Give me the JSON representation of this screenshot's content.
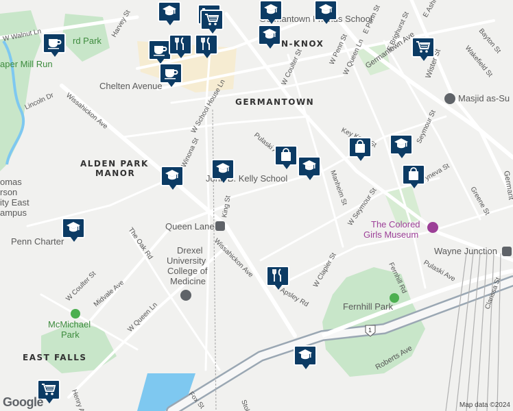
{
  "neighborhoods": [
    {
      "id": "germantown",
      "text": "GERMANTOWN"
    },
    {
      "id": "alden1",
      "text": "ALDEN PARK"
    },
    {
      "id": "alden2",
      "text": "MANOR"
    },
    {
      "id": "eastfalls",
      "text": "EAST FALLS"
    },
    {
      "id": "penknox",
      "text": "N-KNOX"
    }
  ],
  "places": [
    {
      "id": "kelly",
      "text": "John B. Kelly School"
    },
    {
      "id": "queenlane",
      "text": "Queen Lane"
    },
    {
      "id": "drexel1",
      "text": "Drexel"
    },
    {
      "id": "drexel2",
      "text": "University"
    },
    {
      "id": "drexel3",
      "text": "College of"
    },
    {
      "id": "drexel4",
      "text": "Medicine"
    },
    {
      "id": "penncharter",
      "text": "Penn Charter"
    },
    {
      "id": "colored1",
      "text": "The Colored"
    },
    {
      "id": "colored2",
      "text": "Girls Museum"
    },
    {
      "id": "wayne",
      "text": "Wayne Junction"
    },
    {
      "id": "fernhill",
      "text": "Fernhill Park"
    },
    {
      "id": "mcmichael1",
      "text": "McMichael"
    },
    {
      "id": "mcmichael2",
      "text": "Park"
    },
    {
      "id": "masjid",
      "text": "Masjid as-Su"
    },
    {
      "id": "cheltenave",
      "text": "Chelten Avenue"
    },
    {
      "id": "friends",
      "text": "Germantown Friends School"
    },
    {
      "id": "papermill",
      "text": "aper Mill Run"
    },
    {
      "id": "vernonpark",
      "text": "rd Park"
    },
    {
      "id": "tjeu1",
      "text": "omas"
    },
    {
      "id": "tjeu2",
      "text": "rson"
    },
    {
      "id": "tjeu3",
      "text": "ity East"
    },
    {
      "id": "tjeu4",
      "text": "ampus"
    }
  ],
  "streets": [
    {
      "id": "walnut",
      "text": "W Walnut Ln"
    },
    {
      "id": "lincoln",
      "text": "Lincoln Dr"
    },
    {
      "id": "wiss1",
      "text": "Wissahickon Ave"
    },
    {
      "id": "wiss2",
      "text": "Wissahickon Ave"
    },
    {
      "id": "harvey",
      "text": "Harvey St"
    },
    {
      "id": "schoolhouse",
      "text": "W School House Ln"
    },
    {
      "id": "winona",
      "text": "Winona St"
    },
    {
      "id": "king",
      "text": "King St"
    },
    {
      "id": "oakrd",
      "text": "The Oak Rd"
    },
    {
      "id": "midvale",
      "text": "Midvale Ave"
    },
    {
      "id": "queenln",
      "text": "W Queen Ln"
    },
    {
      "id": "coulter1",
      "text": "W Coulter St"
    },
    {
      "id": "coulter2",
      "text": "W Coulter St"
    },
    {
      "id": "pulaski1",
      "text": "Pulaski Ave"
    },
    {
      "id": "pulaski2",
      "text": "Pulaski Ave"
    },
    {
      "id": "pennst",
      "text": "W Penn St"
    },
    {
      "id": "queenst",
      "text": "W Queen Ln"
    },
    {
      "id": "germave",
      "text": "Germantown Ave"
    },
    {
      "id": "wister",
      "text": "Wister St"
    },
    {
      "id": "bringhurst",
      "text": "E Brighurst St"
    },
    {
      "id": "epenn",
      "text": "E Penn St"
    },
    {
      "id": "bayton",
      "text": "Bayton St"
    },
    {
      "id": "wakefield",
      "text": "Wakefield St"
    },
    {
      "id": "manheim",
      "text": "Manheim St"
    },
    {
      "id": "wseymour",
      "text": "W Seymour St"
    },
    {
      "id": "seymour2",
      "text": "Seymour St"
    },
    {
      "id": "clapier",
      "text": "W Clapier St"
    },
    {
      "id": "fernhillrd",
      "text": "Fernhill Rd"
    },
    {
      "id": "wyneva",
      "text": "Wyneva St"
    },
    {
      "id": "greene",
      "text": "Greene St"
    },
    {
      "id": "roberts",
      "text": "Roberts Ave"
    },
    {
      "id": "fox",
      "text": "Fox St"
    },
    {
      "id": "henry",
      "text": "Henry Av"
    },
    {
      "id": "apsley",
      "text": "Apsley Rd"
    },
    {
      "id": "clarissa",
      "text": "Clarissa St"
    },
    {
      "id": "keyknox",
      "text": "Key Knox St"
    },
    {
      "id": "stokes",
      "text": "Stok"
    },
    {
      "id": "germanto2",
      "text": "Germant"
    },
    {
      "id": "ashm",
      "text": "E Ashm"
    },
    {
      "id": "route",
      "text": "1"
    }
  ],
  "pins": [
    {
      "id": "p1",
      "icon": "graduation-cap-icon"
    },
    {
      "id": "p2",
      "icon": "coffee-cup-icon"
    },
    {
      "id": "p3",
      "icon": "shopping-cart-icon"
    },
    {
      "id": "p4",
      "icon": "graduation-cap-icon"
    },
    {
      "id": "p5",
      "icon": "graduation-cap-icon"
    },
    {
      "id": "p6",
      "icon": "coffee-cup-icon"
    },
    {
      "id": "p7",
      "icon": "restaurant-icon"
    },
    {
      "id": "p8",
      "icon": "restaurant-icon"
    },
    {
      "id": "p9",
      "icon": "shopping-cart-icon"
    },
    {
      "id": "p10",
      "icon": "coffee-cup-icon"
    },
    {
      "id": "p11",
      "icon": "graduation-cap-icon"
    },
    {
      "id": "p12",
      "icon": "shopping-bag-icon"
    },
    {
      "id": "p13",
      "icon": "graduation-cap-icon"
    },
    {
      "id": "p14",
      "icon": "shopping-bag-icon"
    },
    {
      "id": "p15",
      "icon": "graduation-cap-icon"
    },
    {
      "id": "p16",
      "icon": "shopping-bag-icon"
    },
    {
      "id": "p17",
      "icon": "graduation-cap-icon"
    },
    {
      "id": "p18",
      "icon": "graduation-cap-icon"
    },
    {
      "id": "p19",
      "icon": "restaurant-icon"
    },
    {
      "id": "p20",
      "icon": "graduation-cap-icon"
    },
    {
      "id": "p21",
      "icon": "shopping-cart-icon"
    },
    {
      "id": "p22",
      "icon": "graduation-cap-icon"
    },
    {
      "id": "p23",
      "icon": "shopping-cart-icon"
    }
  ],
  "attribution": "Map data ©2024",
  "logo": "Google",
  "colors": {
    "pin": "#0c3b64",
    "park": "#c8e6c9",
    "water": "#7ec8f0",
    "road": "#ffffff",
    "poi_purple": "#9c3f97"
  }
}
